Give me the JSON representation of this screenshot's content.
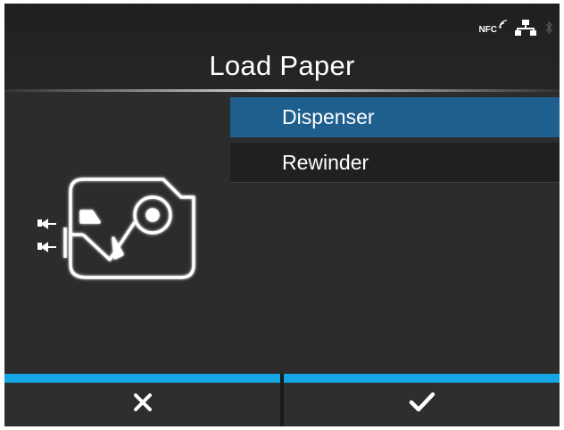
{
  "status": {
    "nfc_label": "NFC",
    "icons": [
      "nfc-icon",
      "network-icon",
      "bluetooth-icon"
    ]
  },
  "header": {
    "title": "Load Paper"
  },
  "menu": {
    "items": [
      {
        "label": "Dispenser",
        "selected": true
      },
      {
        "label": "Rewinder",
        "selected": false
      }
    ]
  },
  "footer": {
    "cancel_icon": "close-icon",
    "ok_icon": "check-icon"
  },
  "colors": {
    "selection": "#1f5f8e",
    "accent_bar": "#15a7e4",
    "background": "#2a2a2a"
  }
}
